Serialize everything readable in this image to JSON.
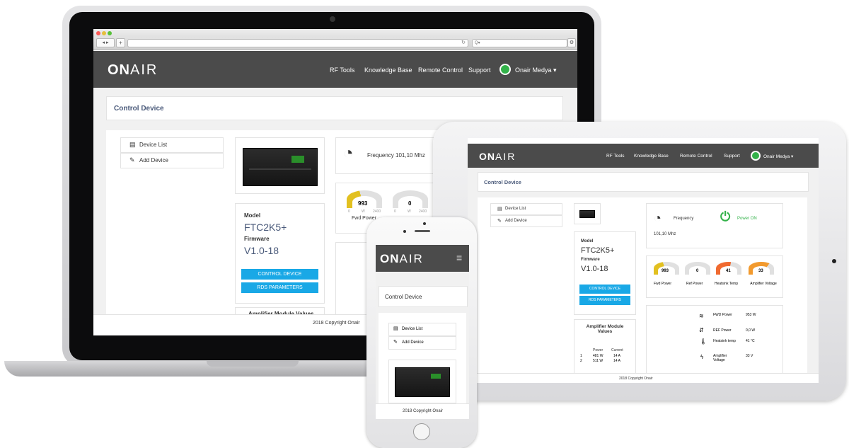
{
  "brand": {
    "logo_on": "ON",
    "logo_air": "AIR"
  },
  "nav": {
    "links": [
      "RF Tools",
      "Knowledge Base",
      "Remote Control",
      "Support"
    ],
    "user": "Onair Medya"
  },
  "browser": {
    "search_placeholder": "Q▾"
  },
  "page": {
    "title": "Control Device",
    "footer": "2018 Copyright Onair"
  },
  "sidebar": {
    "items": [
      "Device List",
      "Add Device"
    ]
  },
  "device": {
    "model_label": "Model",
    "model": "FTC2K5+",
    "firmware_label": "Firmware",
    "firmware": "V1.0-18",
    "control_button": "CONTROL DEVICE",
    "rds_button": "RDS PARAMETERS",
    "amplifier_title": "Amplifier Module Values"
  },
  "status": {
    "frequency_label": "Frequency",
    "frequency_value": "101,10 Mhz",
    "frequency_full": "Frequency 101,10 Mhz",
    "power_status": "Power ON"
  },
  "gauges": [
    {
      "value": "993",
      "label": "Fwd Power",
      "min": "0",
      "unit": "W",
      "max": "2400",
      "fill": 0.41,
      "color": "#e2c020"
    },
    {
      "value": "0",
      "label": "Ref Power",
      "min": "0",
      "unit": "W",
      "max": "2400",
      "fill": 0.0,
      "color": "#cfcfcf"
    },
    {
      "value": "41",
      "label": "Heatsink Temp",
      "fill": 0.55,
      "color": "#f06a30"
    },
    {
      "value": "33",
      "label": "Amplifier Voltage",
      "fill": 0.7,
      "color": "#f29a2e"
    }
  ],
  "amp_table": {
    "headers": [
      "Power",
      "Current"
    ],
    "rows": [
      [
        "1",
        "481 W",
        "14 A"
      ],
      [
        "2",
        "511 W",
        "14 A"
      ]
    ]
  },
  "readings": [
    {
      "label": "FWD Power",
      "value": "953 W"
    },
    {
      "label": "REF Power",
      "value": "0,0 W"
    },
    {
      "label": "Heatsink temp",
      "value": "41 °C"
    },
    {
      "label": "Amplifier Voltage",
      "value": "33 V"
    }
  ],
  "colors": {
    "nav": "#4b4b4b",
    "accent": "#19a8e6",
    "power_on": "#33b24a",
    "yellow": "#e2c020",
    "orange": "#f06a30"
  }
}
